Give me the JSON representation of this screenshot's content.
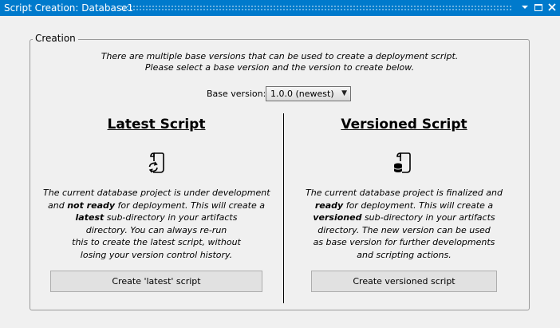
{
  "window": {
    "title": "Script Creation: Database1"
  },
  "group": {
    "label": "Creation"
  },
  "intro": {
    "line1": "There are multiple base versions that can be used to create a deployment script.",
    "line2": "Please select a base version and the version to create below."
  },
  "base_version": {
    "label": "Base version:",
    "selected": "1.0.0 (newest)"
  },
  "latest": {
    "title": "Latest Script",
    "icon": "script-refresh-icon",
    "desc": {
      "l1": "The current database project is under development",
      "l2_pre": "and ",
      "l2_bold": "not ready",
      "l2_post": " for deployment. This will create a",
      "l3_bold": "latest",
      "l3_post": " sub-directory in your artifacts",
      "l4": "directory. You can always re-run",
      "l5": "this to create the latest script, without",
      "l6": "losing your version control history."
    },
    "button": "Create 'latest' script"
  },
  "versioned": {
    "title": "Versioned Script",
    "icon": "script-database-icon",
    "desc": {
      "l1": "The current database project is finalized and",
      "l2_bold": "ready",
      "l2_post": " for deployment. This will create a",
      "l3_bold": "versioned",
      "l3_post": " sub-directory in your artifacts",
      "l4": "directory. The new version can be used",
      "l5": "as base version for further developments",
      "l6": "and scripting actions."
    },
    "button": "Create versioned script"
  },
  "colors": {
    "titlebar": "#007acc",
    "background": "#f0f0f0",
    "button": "#e1e1e1"
  }
}
